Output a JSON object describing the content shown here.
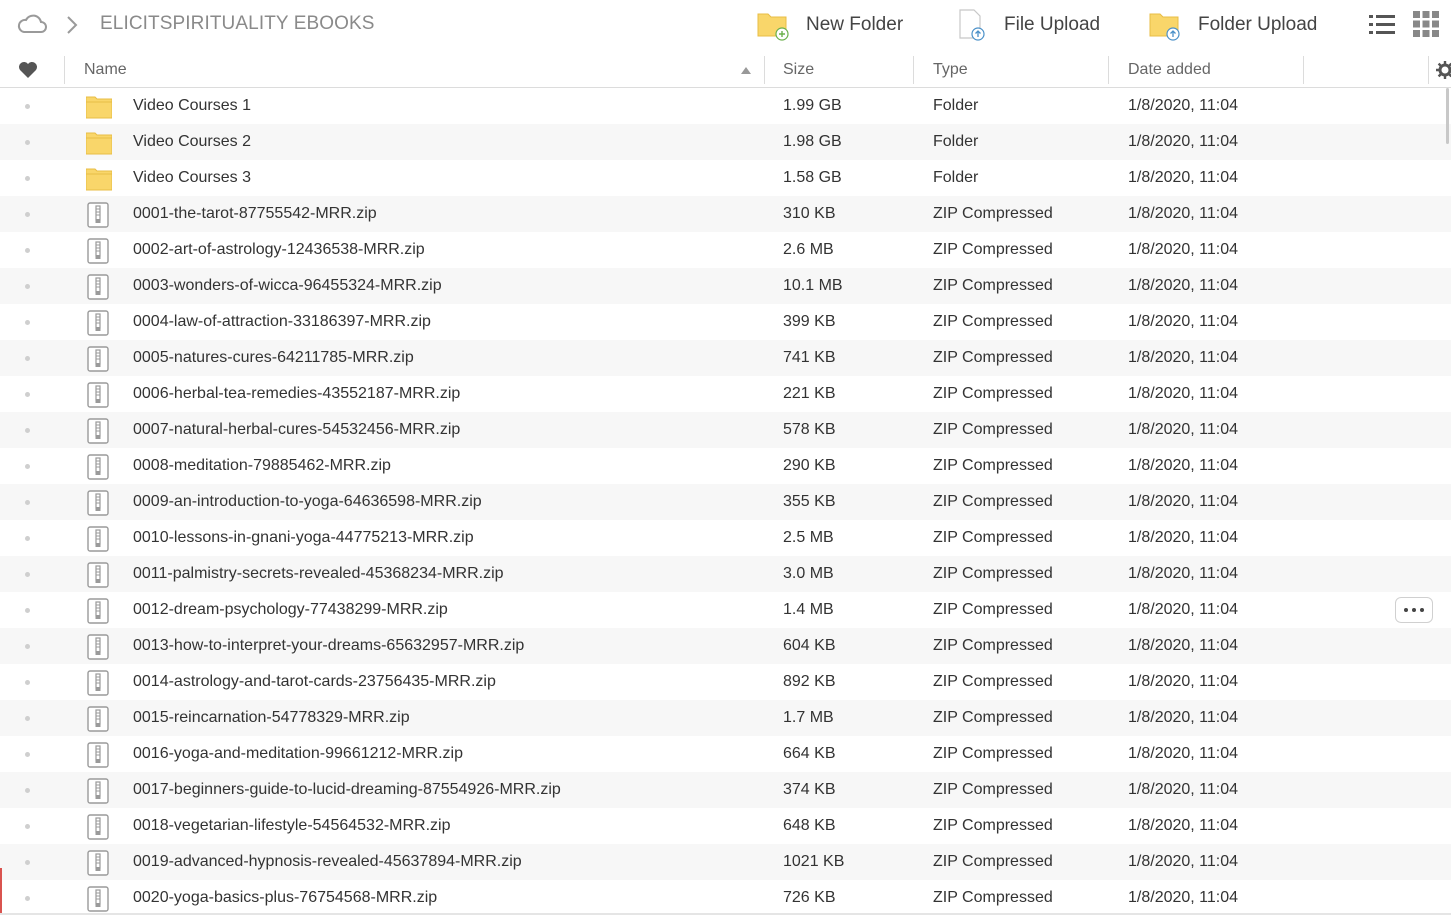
{
  "breadcrumb": {
    "current": "ELICITSPIRITUALITY EBOOKS"
  },
  "toolbar": {
    "new_folder": "New Folder",
    "file_upload": "File Upload",
    "folder_upload": "Folder Upload"
  },
  "columns": {
    "name": "Name",
    "size": "Size",
    "type": "Type",
    "date": "Date added"
  },
  "colors": {
    "folder": "#f9d66a",
    "folder_edge": "#e8bd45",
    "alt_row": "#f7f7f7"
  },
  "rows": [
    {
      "kind": "folder",
      "name": "Video Courses 1",
      "size": "1.99 GB",
      "type": "Folder",
      "date": "1/8/2020, 11:04"
    },
    {
      "kind": "folder",
      "name": "Video Courses 2",
      "size": "1.98 GB",
      "type": "Folder",
      "date": "1/8/2020, 11:04"
    },
    {
      "kind": "folder",
      "name": "Video Courses 3",
      "size": "1.58 GB",
      "type": "Folder",
      "date": "1/8/2020, 11:04"
    },
    {
      "kind": "zip",
      "name": "0001-the-tarot-87755542-MRR.zip",
      "size": "310 KB",
      "type": "ZIP Compressed",
      "date": "1/8/2020, 11:04"
    },
    {
      "kind": "zip",
      "name": "0002-art-of-astrology-12436538-MRR.zip",
      "size": "2.6 MB",
      "type": "ZIP Compressed",
      "date": "1/8/2020, 11:04"
    },
    {
      "kind": "zip",
      "name": "0003-wonders-of-wicca-96455324-MRR.zip",
      "size": "10.1 MB",
      "type": "ZIP Compressed",
      "date": "1/8/2020, 11:04"
    },
    {
      "kind": "zip",
      "name": "0004-law-of-attraction-33186397-MRR.zip",
      "size": "399 KB",
      "type": "ZIP Compressed",
      "date": "1/8/2020, 11:04"
    },
    {
      "kind": "zip",
      "name": "0005-natures-cures-64211785-MRR.zip",
      "size": "741 KB",
      "type": "ZIP Compressed",
      "date": "1/8/2020, 11:04"
    },
    {
      "kind": "zip",
      "name": "0006-herbal-tea-remedies-43552187-MRR.zip",
      "size": "221 KB",
      "type": "ZIP Compressed",
      "date": "1/8/2020, 11:04"
    },
    {
      "kind": "zip",
      "name": "0007-natural-herbal-cures-54532456-MRR.zip",
      "size": "578 KB",
      "type": "ZIP Compressed",
      "date": "1/8/2020, 11:04"
    },
    {
      "kind": "zip",
      "name": "0008-meditation-79885462-MRR.zip",
      "size": "290 KB",
      "type": "ZIP Compressed",
      "date": "1/8/2020, 11:04"
    },
    {
      "kind": "zip",
      "name": "0009-an-introduction-to-yoga-64636598-MRR.zip",
      "size": "355 KB",
      "type": "ZIP Compressed",
      "date": "1/8/2020, 11:04"
    },
    {
      "kind": "zip",
      "name": "0010-lessons-in-gnani-yoga-44775213-MRR.zip",
      "size": "2.5 MB",
      "type": "ZIP Compressed",
      "date": "1/8/2020, 11:04"
    },
    {
      "kind": "zip",
      "name": "0011-palmistry-secrets-revealed-45368234-MRR.zip",
      "size": "3.0 MB",
      "type": "ZIP Compressed",
      "date": "1/8/2020, 11:04"
    },
    {
      "kind": "zip",
      "name": "0012-dream-psychology-77438299-MRR.zip",
      "size": "1.4 MB",
      "type": "ZIP Compressed",
      "date": "1/8/2020, 11:04",
      "hover": true
    },
    {
      "kind": "zip",
      "name": "0013-how-to-interpret-your-dreams-65632957-MRR.zip",
      "size": "604 KB",
      "type": "ZIP Compressed",
      "date": "1/8/2020, 11:04"
    },
    {
      "kind": "zip",
      "name": "0014-astrology-and-tarot-cards-23756435-MRR.zip",
      "size": "892 KB",
      "type": "ZIP Compressed",
      "date": "1/8/2020, 11:04"
    },
    {
      "kind": "zip",
      "name": "0015-reincarnation-54778329-MRR.zip",
      "size": "1.7 MB",
      "type": "ZIP Compressed",
      "date": "1/8/2020, 11:04"
    },
    {
      "kind": "zip",
      "name": "0016-yoga-and-meditation-99661212-MRR.zip",
      "size": "664 KB",
      "type": "ZIP Compressed",
      "date": "1/8/2020, 11:04"
    },
    {
      "kind": "zip",
      "name": "0017-beginners-guide-to-lucid-dreaming-87554926-MRR.zip",
      "size": "374 KB",
      "type": "ZIP Compressed",
      "date": "1/8/2020, 11:04"
    },
    {
      "kind": "zip",
      "name": "0018-vegetarian-lifestyle-54564532-MRR.zip",
      "size": "648 KB",
      "type": "ZIP Compressed",
      "date": "1/8/2020, 11:04"
    },
    {
      "kind": "zip",
      "name": "0019-advanced-hypnosis-revealed-45637894-MRR.zip",
      "size": "1021 KB",
      "type": "ZIP Compressed",
      "date": "1/8/2020, 11:04"
    },
    {
      "kind": "zip",
      "name": "0020-yoga-basics-plus-76754568-MRR.zip",
      "size": "726 KB",
      "type": "ZIP Compressed",
      "date": "1/8/2020, 11:04"
    }
  ]
}
